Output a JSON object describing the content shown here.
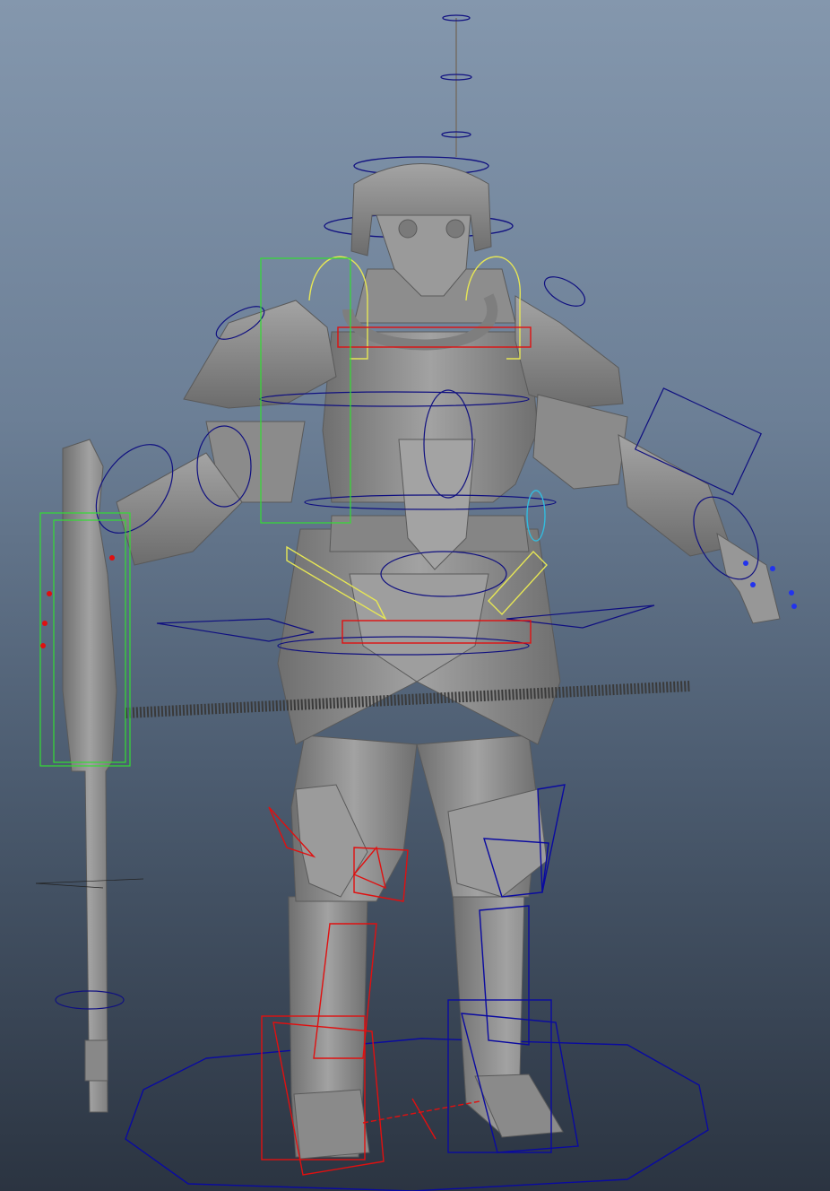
{
  "viewport": {
    "background_top": "#8497ad",
    "background_bottom": "#2b3441"
  },
  "character": {
    "body_color": "#8e8e8e",
    "shade_color": "#6b6b6b",
    "highlight_color": "#a9a9a9"
  },
  "rig": {
    "left_side_color": "#0a0aa0",
    "right_side_color": "#e01010",
    "spine_color": "#101080",
    "clavicle_color": "#e6e655",
    "selection_color": "#33dd33",
    "accent_color": "#33bbdd"
  },
  "icons": [
    "root-control-icon",
    "head-control-icon",
    "ik-foot-control-icon"
  ]
}
